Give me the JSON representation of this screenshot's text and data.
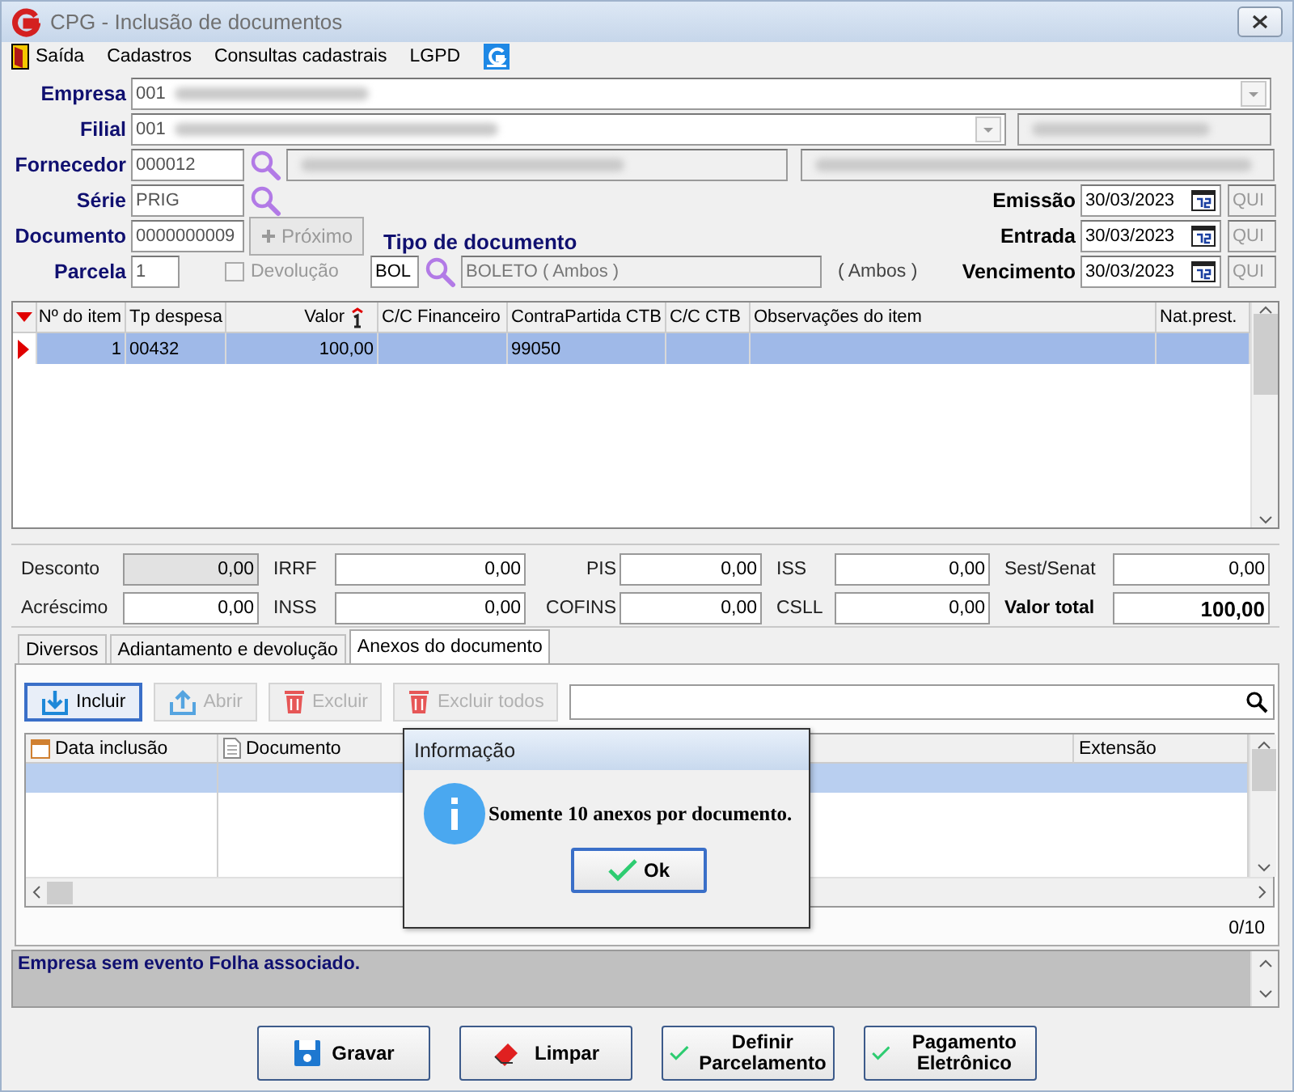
{
  "window": {
    "title": "CPG - Inclusão de documentos"
  },
  "menu": [
    "Saída",
    "Cadastros",
    "Consultas cadastrais",
    "LGPD"
  ],
  "form": {
    "empresa": {
      "label": "Empresa",
      "value": "001"
    },
    "filial": {
      "label": "Filial",
      "value": "001"
    },
    "fornecedor": {
      "label": "Fornecedor",
      "value": "000012"
    },
    "serie": {
      "label": "Série",
      "value": "PRIG"
    },
    "documento": {
      "label": "Documento",
      "value": "0000000009",
      "next_button": {
        "label": "Próximo",
        "disabled": true
      }
    },
    "parcela": {
      "label": "Parcela",
      "value": "1"
    },
    "devolucao": {
      "label": "Devolução",
      "checked": false,
      "disabled": true
    },
    "tipo_documento": {
      "label": "Tipo de documento",
      "code": "BOL",
      "description": "BOLETO ( Ambos )",
      "note": "( Ambos )"
    },
    "dates": [
      {
        "label": "Emissão",
        "value": "30/03/2023",
        "weekday": "QUI"
      },
      {
        "label": "Entrada",
        "value": "30/03/2023",
        "weekday": "QUI"
      },
      {
        "label": "Vencimento",
        "value": "30/03/2023",
        "weekday": "QUI"
      }
    ]
  },
  "items_table": {
    "columns": [
      {
        "label": "Nº do item",
        "sorted": false
      },
      {
        "label": "Tp despesa",
        "sorted": false
      },
      {
        "label": "Valor",
        "sorted": true
      },
      {
        "label": "C/C Financeiro",
        "sorted": false
      },
      {
        "label": "ContraPartida CTB",
        "sorted": false
      },
      {
        "label": "C/C CTB",
        "sorted": false
      },
      {
        "label": "Observações do item",
        "sorted": false
      },
      {
        "label": "Nat.prest.",
        "sorted": false
      }
    ],
    "rows": [
      {
        "selected": true,
        "item_no": "1",
        "tp_despesa": "00432",
        "valor": "100,00",
        "contrapartida_ctb": "99050"
      }
    ]
  },
  "totals": [
    {
      "label": "Desconto",
      "value": "0,00",
      "disabled": true,
      "total": false
    },
    {
      "label": "IRRF",
      "value": "0,00",
      "disabled": false,
      "total": false
    },
    {
      "label": "PIS",
      "value": "0,00",
      "disabled": false,
      "total": false
    },
    {
      "label": "ISS",
      "value": "0,00",
      "disabled": false,
      "total": false
    },
    {
      "label": "Sest/Senat",
      "value": "0,00",
      "disabled": false,
      "total": false
    },
    {
      "label": "Acréscimo",
      "value": "0,00",
      "disabled": false,
      "total": false
    },
    {
      "label": "INSS",
      "value": "0,00",
      "disabled": false,
      "total": false
    },
    {
      "label": "COFINS",
      "value": "0,00",
      "disabled": false,
      "total": false
    },
    {
      "label": "CSLL",
      "value": "0,00",
      "disabled": false,
      "total": false
    },
    {
      "label": "Valor total",
      "value": "100,00",
      "disabled": false,
      "total": true
    }
  ],
  "tabs": [
    {
      "label": "Diversos",
      "selected": false
    },
    {
      "label": "Adiantamento e devolução",
      "selected": false
    },
    {
      "label": "Anexos do documento",
      "selected": true
    }
  ],
  "attachments": {
    "toolbar": [
      {
        "kind": "include",
        "label": "Incluir",
        "disabled": false
      },
      {
        "kind": "open",
        "label": "Abrir",
        "disabled": true
      },
      {
        "kind": "delete",
        "label": "Excluir",
        "disabled": true
      },
      {
        "kind": "delete",
        "label": "Excluir todos",
        "disabled": true
      }
    ],
    "columns": [
      "Data inclusão",
      "Documento",
      "Extensão"
    ],
    "rows": [
      {
        "selected": true
      },
      {
        "selected": false
      }
    ],
    "counter": "0/10"
  },
  "status_message": "Empresa sem evento Folha associado.",
  "buttons": [
    {
      "kind": "save",
      "label": "Gravar"
    },
    {
      "kind": "clear",
      "label": "Limpar"
    },
    {
      "kind": "check",
      "label": "Definir Parcelamento"
    },
    {
      "kind": "check",
      "label": "Pagamento Eletrônico"
    }
  ],
  "dialog": {
    "title": "Informação",
    "message": "Somente 10 anexos por documento.",
    "button": "Ok"
  }
}
